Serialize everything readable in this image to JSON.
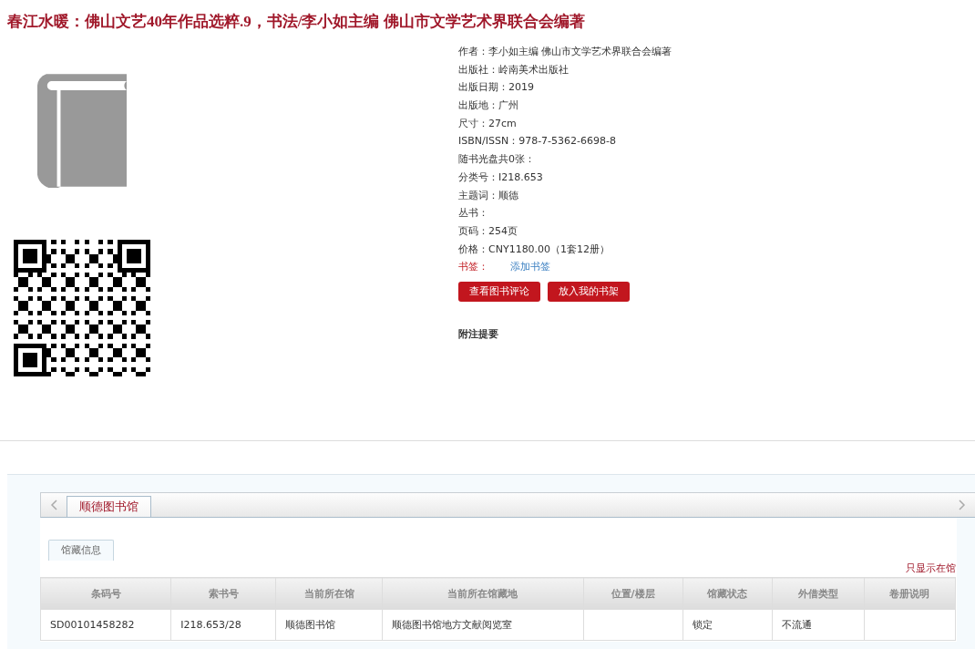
{
  "title": "春江水暖：佛山文艺40年作品选粹.9，书法/李小如主编 佛山市文学艺术界联合会编著",
  "details": [
    {
      "kind": "text",
      "label": "作者：",
      "value": "李小如主编 佛山市文学艺术界联合会编著"
    },
    {
      "kind": "text",
      "label": "出版社：",
      "value": "岭南美术出版社"
    },
    {
      "kind": "text",
      "label": "出版日期：",
      "value": "2019"
    },
    {
      "kind": "text",
      "label": "出版地：",
      "value": "广州"
    },
    {
      "kind": "text",
      "label": "尺寸：",
      "value": "27cm"
    },
    {
      "kind": "text",
      "label": "ISBN/ISSN：",
      "value": "978-7-5362-6698-8"
    },
    {
      "kind": "text",
      "label": "随书光盘共0张："
    },
    {
      "kind": "text",
      "label": "分类号：",
      "value": "I218.653"
    },
    {
      "kind": "text",
      "label": "主题词：",
      "value": "顺德"
    },
    {
      "kind": "text",
      "label": "丛书："
    },
    {
      "kind": "text",
      "label": "页码：",
      "value": "254页"
    },
    {
      "kind": "text",
      "label": "价格：",
      "value": "CNY1180.00（1套12册）"
    },
    {
      "kind": "link",
      "label": "书签：",
      "value": "添加书签"
    }
  ],
  "buttons": [
    "查看图书评论",
    "放入我的书架"
  ],
  "notes_heading": "附注提要",
  "library_tabs": [
    {
      "label": "顺德图书馆",
      "selected": true
    }
  ],
  "sub_tabs": [
    {
      "label": "馆藏信息",
      "selected": true
    }
  ],
  "filter_link": "只显示在馆",
  "table": {
    "columns": [
      "条码号",
      "索书号",
      "当前所在馆",
      "当前所在馆藏地",
      "位置/楼层",
      "馆藏状态",
      "外借类型",
      "卷册说明"
    ],
    "rows": [
      [
        "SD00101458282",
        "I218.653/28",
        "顺德图书馆",
        "顺德图书馆地方文献阅览室",
        "",
        "锁定",
        "不流通",
        ""
      ]
    ]
  }
}
